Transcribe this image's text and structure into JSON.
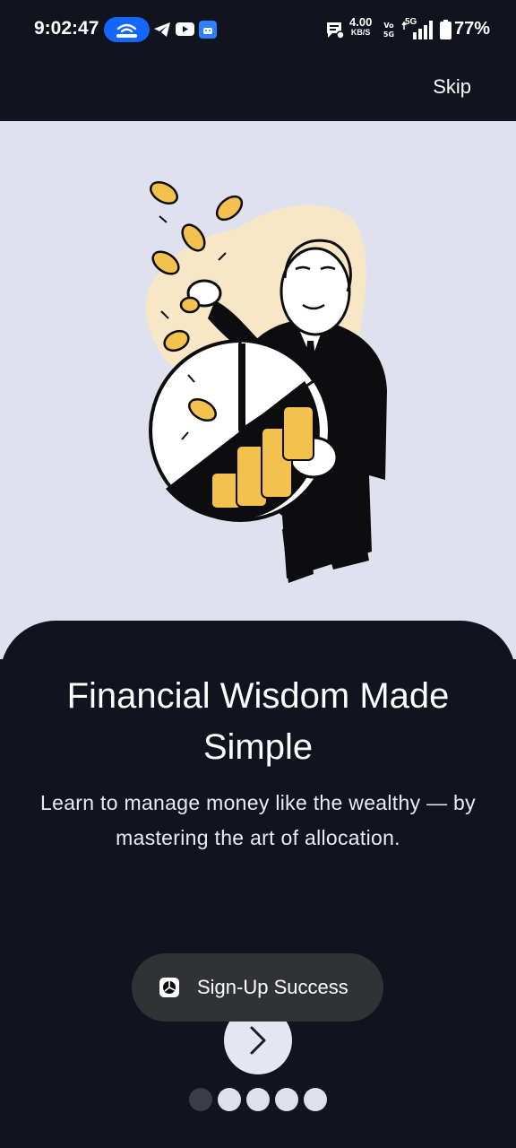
{
  "status_bar": {
    "time": "9:02:47",
    "net_speed": "4.00",
    "net_speed_unit": "KB/S",
    "network": "5G",
    "battery": "77%"
  },
  "header": {
    "skip_label": "Skip"
  },
  "onboarding": {
    "title": "Financial Wisdom Made Simple",
    "subtitle": "Learn to manage money like the wealthy — by mastering the art of allocation.",
    "page_index": 1,
    "page_count": 5
  },
  "toast": {
    "text": "Sign-Up Success"
  },
  "colors": {
    "background": "#11141e",
    "hero_bg": "#dfe2ee",
    "coin": "#f2c14e",
    "toast_bg": "#303236"
  }
}
